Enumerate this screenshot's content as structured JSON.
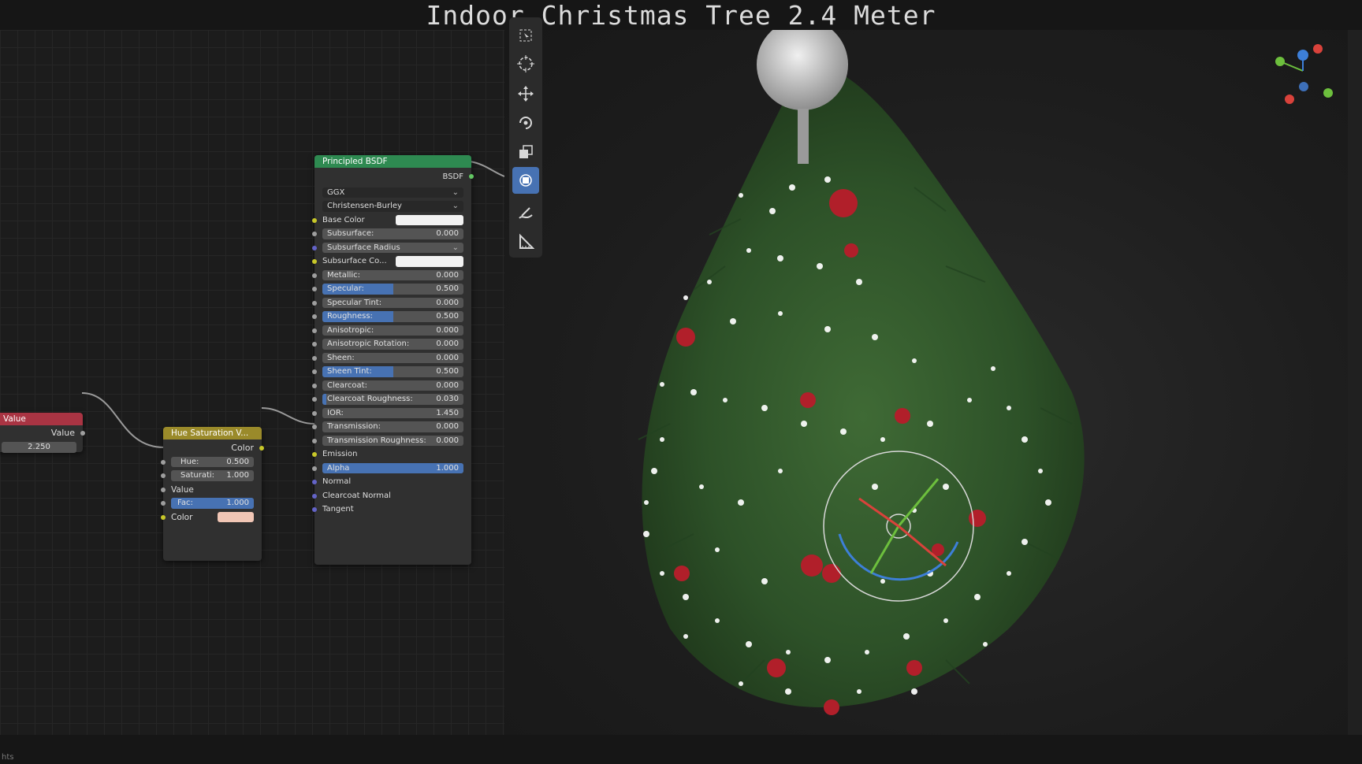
{
  "window": {
    "title": "Indoor Christmas Tree 2.4 Meter"
  },
  "status": {
    "text": "hts"
  },
  "value_node": {
    "title": "Value",
    "output_label": "Value",
    "value": "2.250"
  },
  "hue_node": {
    "title": "Hue Saturation V...",
    "output_label": "Color",
    "hue_label": "Hue:",
    "hue_value": "0.500",
    "hue_fraction": 0.5,
    "saturation_label": "Saturati:",
    "saturation_value": "1.000",
    "saturation_fraction": 1.0,
    "value_label": "Value",
    "fac_label": "Fac:",
    "fac_value": "1.000",
    "fac_fraction": 1.0,
    "color_label": "Color",
    "color_swatch": "#f1c6b5"
  },
  "bsdf_node": {
    "title": "Principled BSDF",
    "output_label": "BSDF",
    "distribution": "GGX",
    "subsurface_method": "Christensen-Burley",
    "base_color_label": "Base Color",
    "base_color_swatch": "#f2f2f2",
    "fields": [
      {
        "label": "Subsurface:",
        "value": "0.000",
        "fraction": 0.0
      },
      {
        "label": "Subsurface Radius",
        "dropdown": true
      },
      {
        "label": "Subsurface Co...",
        "swatch": "#f2f2f2"
      },
      {
        "label": "Metallic:",
        "value": "0.000",
        "fraction": 0.0
      },
      {
        "label": "Specular:",
        "value": "0.500",
        "fraction": 0.5
      },
      {
        "label": "Specular Tint:",
        "value": "0.000",
        "fraction": 0.0
      },
      {
        "label": "Roughness:",
        "value": "0.500",
        "fraction": 0.5
      },
      {
        "label": "Anisotropic:",
        "value": "0.000",
        "fraction": 0.0
      },
      {
        "label": "Anisotropic Rotation:",
        "value": "0.000",
        "fraction": 0.0
      },
      {
        "label": "Sheen:",
        "value": "0.000",
        "fraction": 0.0
      },
      {
        "label": "Sheen Tint:",
        "value": "0.500",
        "fraction": 0.5
      },
      {
        "label": "Clearcoat:",
        "value": "0.000",
        "fraction": 0.0
      },
      {
        "label": "Clearcoat Roughness:",
        "value": "0.030",
        "fraction": 0.03
      },
      {
        "label": "IOR:",
        "value": "1.450",
        "fraction": 0.0
      },
      {
        "label": "Transmission:",
        "value": "0.000",
        "fraction": 0.0
      },
      {
        "label": "Transmission Roughness:",
        "value": "0.000",
        "fraction": 0.0
      }
    ],
    "emission_label": "Emission",
    "alpha_label": "Alpha",
    "alpha_value": "1.000",
    "alpha_fraction": 1.0,
    "sockets": [
      "Normal",
      "Clearcoat Normal",
      "Tangent"
    ]
  },
  "toolbar": {
    "tools": [
      "select-box-icon",
      "cursor-icon",
      "move-icon",
      "rotate-icon",
      "scale-icon",
      "transform-icon",
      "annotate-icon",
      "measure-icon"
    ],
    "active_tool": "transform-icon"
  },
  "colors": {
    "value_header": "#a93443",
    "hue_header": "#9a8a2a",
    "bsdf_header": "#2e8a51",
    "accent": "#4772b3"
  }
}
